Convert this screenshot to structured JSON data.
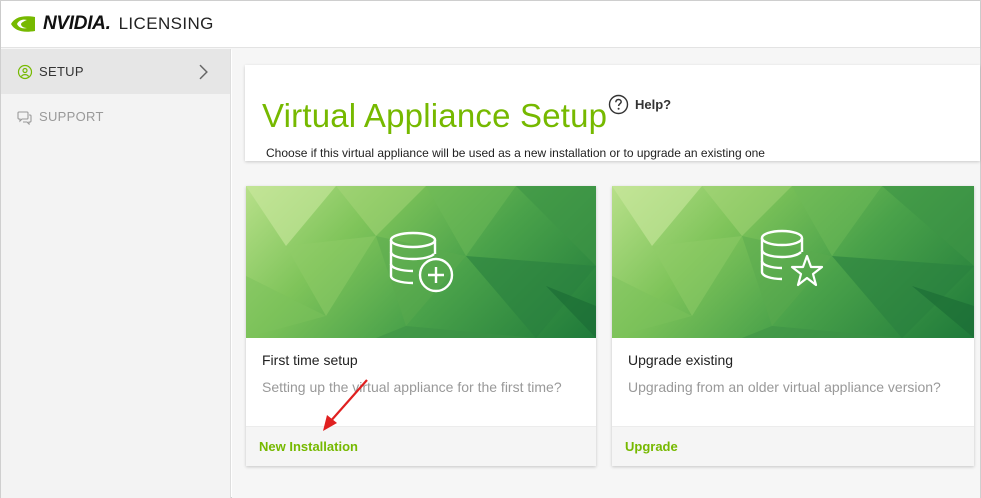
{
  "app": {
    "brand_name": "NVIDIA.",
    "brand_sub": "LICENSING"
  },
  "sidebar": {
    "items": [
      {
        "label": "SETUP",
        "icon": "setup-icon",
        "active": true
      },
      {
        "label": "SUPPORT",
        "icon": "support-icon",
        "active": false
      }
    ]
  },
  "header": {
    "title": "Virtual Appliance Setup",
    "help_label": "Help?",
    "subtitle": "Choose if this virtual appliance will be used as a new installation or to upgrade an existing one"
  },
  "cards": [
    {
      "title": "First time setup",
      "description": "Setting up the virtual appliance for the first time?",
      "action_label": "New Installation",
      "icon": "database-plus-icon"
    },
    {
      "title": "Upgrade existing",
      "description": "Upgrading from an older virtual appliance version?",
      "action_label": "Upgrade",
      "icon": "database-star-icon"
    }
  ],
  "colors": {
    "accent": "#76b900",
    "annotation_arrow": "#e02020"
  }
}
